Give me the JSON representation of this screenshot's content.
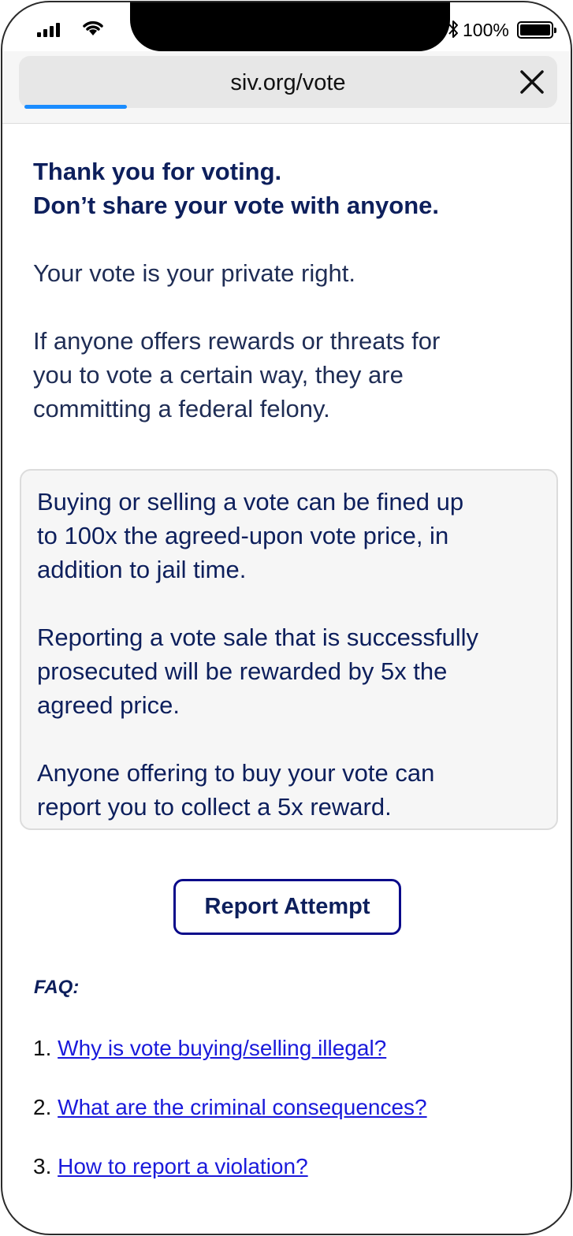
{
  "status": {
    "battery": "100%"
  },
  "browser": {
    "url": "siv.org/vote",
    "progress_fraction": 0.19
  },
  "main": {
    "heading_line1": "Thank you for voting.",
    "heading_line2": "Don’t share your vote with anyone.",
    "private_right": "Your vote is your private right.",
    "felony_line1": "If anyone offers rewards or threats for",
    "felony_line2": "you to vote a certain way, they are",
    "felony_line3": "committing a federal felony."
  },
  "info_box": {
    "p1_line1": "Buying or selling a vote can be fined up",
    "p1_line2": "to 100x the agreed-upon vote price, in",
    "p1_line3": "addition to jail time.",
    "p2_line1": "Reporting a vote sale that is successfully",
    "p2_line2": "prosecuted will be rewarded by 5x the",
    "p2_line3": "agreed price.",
    "p3_line1": "Anyone offering to buy your vote can",
    "p3_line2": "report you to collect a 5x reward."
  },
  "report_button": "Report Attempt",
  "faq": {
    "title": "FAQ:",
    "items": [
      {
        "number": "1.",
        "label": "Why is vote buying/selling illegal?"
      },
      {
        "number": "2.",
        "label": "What are the criminal consequences?"
      },
      {
        "number": "3.",
        "label": "How to report a violation?"
      }
    ]
  },
  "colors": {
    "heading": "#0d1f5c",
    "link": "#1a1adb",
    "progress": "#1a8cff",
    "button_border": "#0a0a8a"
  }
}
